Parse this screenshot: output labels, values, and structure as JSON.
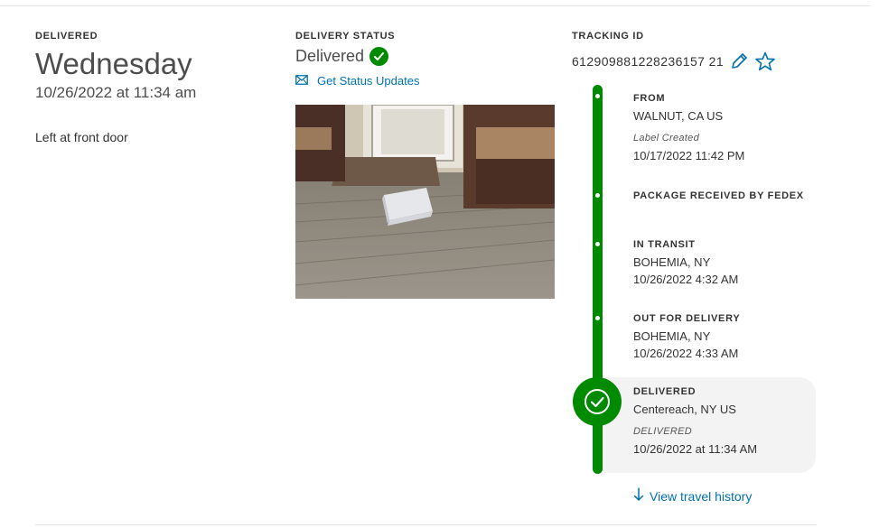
{
  "delivered_block": {
    "label": "DELIVERED",
    "day": "Wednesday",
    "datetime": "10/26/2022 at 11:34 am",
    "note": "Left at front door"
  },
  "status_block": {
    "label": "DELIVERY STATUS",
    "status": "Delivered",
    "updates_link": "Get Status Updates",
    "photo_icon": "delivery-photo"
  },
  "tracking_block": {
    "label": "TRACKING ID",
    "tracking_id": "612909881228236157 21"
  },
  "events": [
    {
      "title": "FROM",
      "line1": "WALNUT, CA US",
      "note": "Label Created",
      "line2": "10/17/2022 11:42 PM"
    },
    {
      "title": "PACKAGE RECEIVED BY FEDEX"
    },
    {
      "title": "IN TRANSIT",
      "line1": "BOHEMIA, NY",
      "line2": "10/26/2022 4:32 AM"
    },
    {
      "title": "OUT FOR DELIVERY",
      "line1": "BOHEMIA, NY",
      "line2": "10/26/2022 4:33 AM"
    },
    {
      "title": "DELIVERED",
      "line1": "Centereach, NY US",
      "note": "DELIVERED",
      "line2": "10/26/2022 at 11:34 AM"
    }
  ],
  "history_link": "View travel history",
  "colors": {
    "accent_green": "#008a00",
    "link_blue": "#0072b1"
  },
  "icons": [
    "check-icon",
    "mail-icon",
    "pencil-icon",
    "star-icon",
    "arrow-down-icon"
  ]
}
